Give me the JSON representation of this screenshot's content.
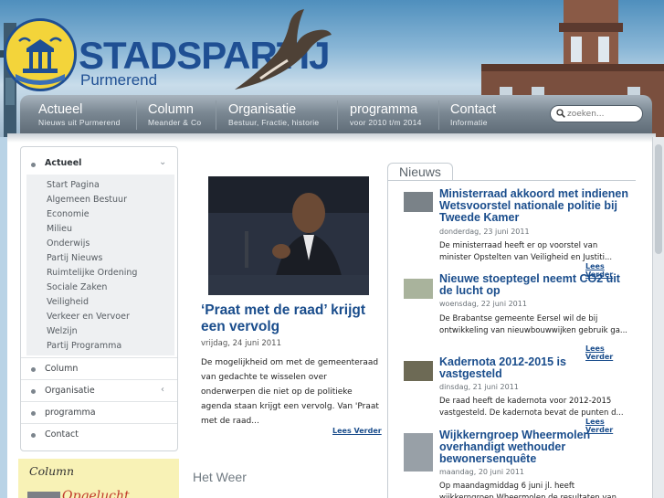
{
  "brand": {
    "name": "STADSPARTIJ",
    "city": "Purmerend"
  },
  "nav": [
    {
      "label": "Actueel",
      "sub": "Nieuws uit Purmerend"
    },
    {
      "label": "Column",
      "sub": "Meander & Co"
    },
    {
      "label": "Organisatie",
      "sub": "Bestuur, Fractie, historie"
    },
    {
      "label": "programma",
      "sub": "voor 2010 t/m 2014"
    },
    {
      "label": "Contact",
      "sub": "Informatie"
    }
  ],
  "search": {
    "placeholder": "zoeken..."
  },
  "sidebar": {
    "active": "Actueel",
    "sub_items": [
      "Start Pagina",
      "Algemeen Bestuur",
      "Economie",
      "Milieu",
      "Onderwijs",
      "Partij Nieuws",
      "Ruimtelijke Ordening",
      "Sociale Zaken",
      "Veiligheid",
      "Verkeer en Vervoer",
      "Welzijn",
      "Partij Programma"
    ],
    "items": [
      "Column",
      "Organisatie",
      "programma",
      "Contact"
    ]
  },
  "column_box": {
    "title": "Column",
    "teaser": "Opgelucht"
  },
  "main": {
    "title": "‘Praat met de raad’ krijgt een vervolg",
    "date": "vrijdag, 24 juni 2011",
    "body": "De mogelijkheid om met de gemeenteraad van gedachte te wisselen over onderwerpen die niet op de politieke agenda staan krijgt een vervolg. Van 'Praat met de raad...",
    "more": "Lees Verder"
  },
  "weather": {
    "title": "Het Weer"
  },
  "news": {
    "tab": "Nieuws",
    "items": [
      {
        "title": "Ministerraad akkoord met indienen Wetsvoorstel nationale politie bij Tweede Kamer",
        "date": "donderdag, 23 juni 2011",
        "body": "De ministerraad heeft er op voorstel van minister Opstelten van Veiligheid en Justiti...",
        "more": "Lees Verder"
      },
      {
        "title": "Nieuwe stoeptegel neemt CO2 uit de lucht op",
        "date": "woensdag, 22 juni 2011",
        "body": "De Brabantse gemeente Eersel wil de bij ontwikkeling van nieuwbouwwijken gebruik ga...",
        "more": "Lees Verder"
      },
      {
        "title": "Kadernota 2012-2015 is vastgesteld",
        "date": "dinsdag, 21 juni 2011",
        "body": "De raad heeft de kadernota voor 2012-2015 vastgesteld. De kadernota bevat de punten d...",
        "more": "Lees Verder"
      },
      {
        "title": "Wijkkerngroep Wheermolen overhandigt wethouder bewonersenquête",
        "date": "maandag, 20 juni 2011",
        "body": "Op maandagmiddag 6 juni jl. heeft wijkkerngroep Wheermolen de resultaten van"
      }
    ]
  },
  "colors": {
    "brand_blue": "#1f4f93",
    "link_blue": "#1a4d8c",
    "logo_yellow": "#f3d43a",
    "nav_gray": "#6f7c87"
  }
}
